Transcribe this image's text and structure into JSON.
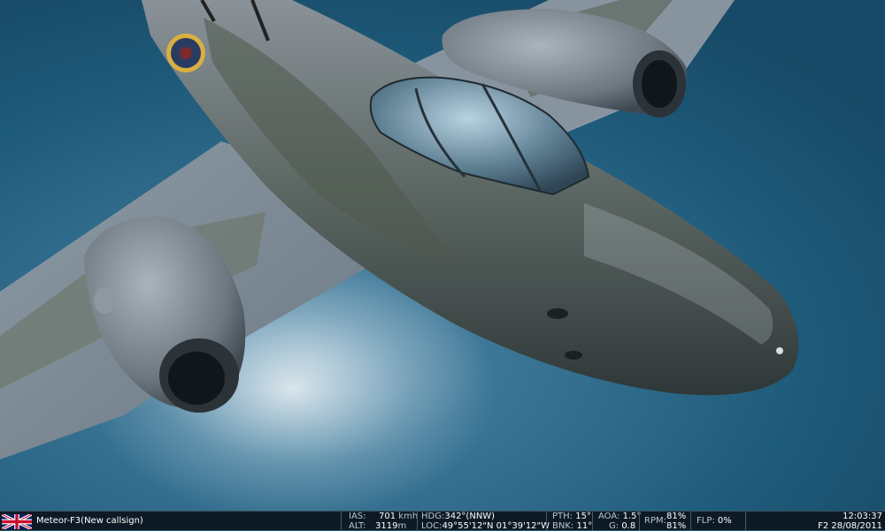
{
  "aircraft": {
    "callsign": "Meteor-F3(New callsign)",
    "flag_icon": "uk-flag-icon"
  },
  "hud": {
    "ias_label": "IAS:",
    "ias_value": "701",
    "ias_unit": "kmh",
    "alt_label": "ALT:",
    "alt_value": "3119",
    "alt_unit": "m",
    "hdg_label": "HDG:",
    "hdg_value": "342°(NNW)",
    "loc_label": "LOC:",
    "loc_value": "49°55'12\"N 01°39'12\"W",
    "pth_label": "PTH:",
    "pth_value": "15°",
    "bnk_label": "BNK:",
    "bnk_value": "11°",
    "aoa_label": "AOA:",
    "aoa_value": "1.5°",
    "g_label": "G:",
    "g_value": "0.8",
    "rpm_label": "RPM:",
    "rpm_value_1": "81%",
    "rpm_value_2": "81%",
    "flp_label": "FLP:",
    "flp_value": "0%",
    "time": "12:03:37",
    "date": "F2 28/08/2011"
  },
  "colors": {
    "sea": "#1f5a78",
    "hud_bg": "#0d1a26",
    "aircraft_grey": "#6e7880",
    "aircraft_green": "#5c6650"
  }
}
